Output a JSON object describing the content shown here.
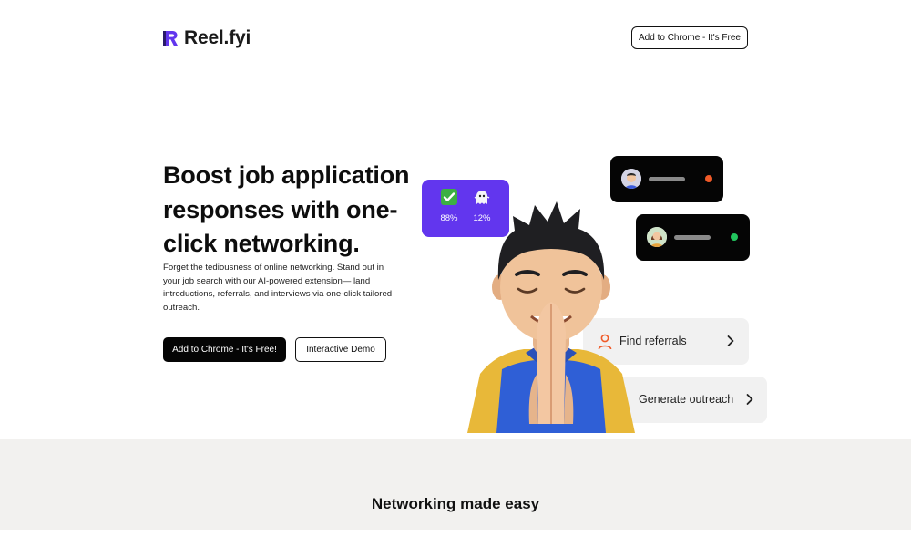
{
  "header": {
    "logo_text": "Reel.fyi",
    "cta_label": "Add to Chrome - It's Free"
  },
  "hero": {
    "title": "Boost job application responses with one-click networking.",
    "description": "Forget the tediousness of online networking. Stand out in your job search with our AI-powered extension— land introductions, referrals, and interviews via one-click tailored outreach.",
    "primary_button": "Add to Chrome - It's Free!",
    "secondary_button": "Interactive Demo"
  },
  "stats": [
    {
      "icon": "check-mark-icon",
      "value": "88%"
    },
    {
      "icon": "ghost-icon",
      "value": "12%"
    }
  ],
  "messages": [
    {
      "avatar": "male-avatar-icon",
      "status_color": "#f05a28"
    },
    {
      "avatar": "female-avatar-icon",
      "status_color": "#22c55e"
    }
  ],
  "actions": [
    {
      "label": "Find referrals",
      "icon": "person-icon"
    },
    {
      "label": "Generate outreach",
      "icon": ""
    }
  ],
  "section": {
    "title": "Networking made easy"
  },
  "colors": {
    "brand_purple": "#6236ee",
    "accent_orange": "#f05a28",
    "dark": "#050505",
    "lower_bg": "#f2f1ef"
  }
}
